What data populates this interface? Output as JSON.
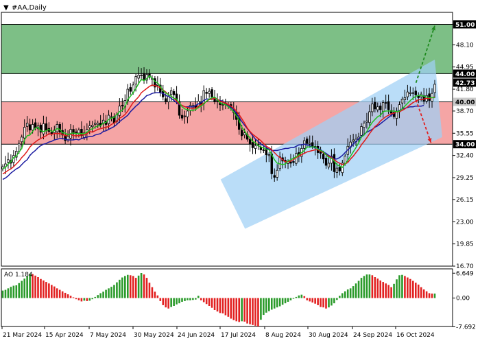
{
  "header": {
    "arrow": "▼",
    "symbol": "#AA,Daily"
  },
  "ao_label": "AO 1.184",
  "colors": {
    "bull": "#2a9a2a",
    "bear": "#e22020",
    "candle": "#000000",
    "ma_fast": "#22c022",
    "ma_mid": "#e01818",
    "ma_slow": "#1a1aa0",
    "zone_green": "#7dbf86",
    "zone_red": "#f5a5a5",
    "channel": "#9fd0f5",
    "arrow_up": "#1e8a1e",
    "arrow_down": "#e22020",
    "current_price": "#c9c9c9"
  },
  "chart_data": [
    {
      "type": "candlestick",
      "title": "#AA,Daily",
      "ylim": [
        16.7,
        52.7
      ],
      "price_ticks": [
        "51.00",
        "48.10",
        "44.95",
        "41.80",
        "38.70",
        "35.55",
        "32.40",
        "29.25",
        "26.15",
        "23.00",
        "19.85",
        "16.70"
      ],
      "levels": [
        {
          "value": "51.00",
          "color": "#000000",
          "text_color": "#ffffff"
        },
        {
          "value": "44.00",
          "color": "#000000",
          "text_color": "#ffffff"
        },
        {
          "value": "42.73",
          "color": "#000000",
          "text_color": "#ffffff"
        },
        {
          "value": "40.00",
          "color": "#c9c9c9",
          "text_color": "#000000"
        },
        {
          "value": "34.00",
          "color": "#000000",
          "text_color": "#ffffff"
        }
      ],
      "zones": [
        {
          "kind": "buy_target",
          "from": 44.0,
          "to": 51.0
        },
        {
          "kind": "sell_target",
          "from": 34.0,
          "to": 40.0
        }
      ],
      "channel": {
        "lower": [
          {
            "x": "2024-07-22",
            "y": 22.0
          },
          {
            "x": "2024-11-04",
            "y": 35.0
          }
        ],
        "upper": [
          {
            "x": "2024-07-09",
            "y": 29.0
          },
          {
            "x": "2024-10-31",
            "y": 46.0
          }
        ]
      },
      "arrows": [
        {
          "from": {
            "x": "2024-10-21",
            "y": 42.7
          },
          "to": {
            "x": "2024-10-31",
            "y": 50.8
          },
          "direction": "up"
        },
        {
          "from": {
            "x": "2024-10-21",
            "y": 40.3
          },
          "to": {
            "x": "2024-10-29",
            "y": 34.2
          },
          "direction": "down"
        }
      ],
      "x_labels": [
        "21 Mar 2024",
        "15 Apr 2024",
        "7 May 2024",
        "30 May 2024",
        "24 Jun 2024",
        "17 Jul 2024",
        "8 Aug 2024",
        "30 Aug 2024",
        "24 Sep 2024",
        "16 Oct 2024"
      ],
      "close": [
        30.8,
        31.2,
        31.8,
        31.3,
        32.4,
        33.0,
        34.1,
        35.0,
        36.4,
        37.0,
        36.0,
        36.8,
        36.3,
        36.6,
        35.7,
        36.9,
        36.0,
        35.8,
        35.5,
        36.0,
        36.8,
        35.7,
        35.3,
        34.5,
        35.1,
        36.1,
        35.5,
        35.7,
        36.0,
        35.2,
        35.6,
        36.1,
        36.6,
        36.7,
        37.0,
        37.0,
        36.7,
        37.4,
        36.8,
        38.1,
        37.9,
        37.0,
        38.2,
        39.4,
        39.5,
        40.2,
        41.8,
        41.5,
        42.4,
        43.6,
        43.8,
        43.8,
        43.2,
        43.9,
        43.5,
        43.3,
        42.1,
        42.5,
        41.4,
        40.7,
        40.0,
        40.8,
        41.6,
        41.0,
        40.3,
        38.1,
        37.7,
        38.0,
        38.7,
        39.5,
        39.5,
        39.2,
        40.1,
        39.6,
        41.6,
        41.2,
        41.5,
        40.7,
        40.0,
        40.2,
        39.6,
        39.6,
        39.6,
        39.5,
        39.1,
        38.5,
        37.5,
        36.1,
        35.2,
        35.6,
        34.7,
        34.0,
        33.5,
        33.8,
        33.8,
        33.2,
        33.1,
        32.5,
        32.5,
        29.8,
        29.3,
        30.3,
        32.2,
        31.6,
        31.5,
        31.5,
        31.3,
        31.4,
        32.7,
        32.5,
        33.4,
        34.5,
        34.1,
        34.1,
        33.7,
        33.7,
        32.8,
        32.7,
        31.9,
        31.0,
        31.3,
        32.3,
        30.1,
        30.6,
        30.2,
        31.3,
        32.3,
        33.7,
        34.3,
        34.6,
        34.7,
        35.0,
        36.5,
        37.0,
        37.3,
        38.6,
        39.7,
        39.0,
        39.3,
        38.9,
        39.9,
        39.8,
        38.9,
        38.4,
        37.9,
        38.6,
        39.6,
        40.4,
        40.6,
        41.4,
        41.3,
        41.3,
        41.0,
        40.6,
        41.1,
        40.1,
        40.9,
        40.2,
        41.2,
        42.5
      ],
      "ma_fast": [
        30.5,
        30.7,
        31.2,
        31.5,
        32.1,
        32.3,
        32.9,
        33.4,
        34.6,
        35.2,
        35.3,
        35.8,
        36.3,
        36.4,
        35.9,
        35.8,
        35.9,
        36.1,
        35.8,
        35.9,
        36.2,
        36.1,
        35.6,
        35.6,
        35.3,
        35.5,
        35.6,
        35.5,
        35.5,
        35.5,
        35.5,
        35.7,
        36.0,
        36.2,
        36.4,
        36.6,
        36.6,
        37.0,
        37.1,
        37.5,
        37.7,
        37.8,
        38.2,
        38.6,
        38.8,
        39.3,
        40.3,
        40.8,
        41.3,
        41.9,
        42.6,
        43.2,
        43.0,
        43.3,
        43.7,
        43.4,
        42.9,
        42.7,
        42.2,
        41.6,
        41.3,
        41.0,
        40.8,
        40.5,
        40.4,
        39.9,
        39.3,
        39.0,
        38.9,
        38.8,
        38.8,
        38.9,
        39.2,
        39.4,
        39.7,
        40.1,
        40.4,
        40.6,
        40.7,
        40.3,
        39.9,
        39.7,
        39.6,
        39.3,
        39.0,
        38.6,
        38.0,
        37.4,
        36.4,
        35.9,
        35.3,
        34.9,
        34.4,
        34.2,
        33.8,
        33.6,
        33.5,
        33.3,
        33.2,
        32.5,
        31.8,
        31.3,
        31.2,
        31.1,
        31.2,
        31.6,
        31.8,
        32.0,
        32.2,
        32.5,
        32.8,
        33.1,
        33.6,
        33.6,
        33.6,
        33.6,
        33.3,
        33.1,
        32.9,
        32.5,
        32.1,
        32.0,
        31.6,
        31.1,
        30.9,
        30.7,
        31.2,
        31.7,
        32.3,
        32.9,
        33.5,
        34.2,
        35.0,
        35.3,
        35.8,
        36.5,
        37.1,
        37.5,
        37.9,
        38.1,
        38.6,
        38.7,
        38.7,
        38.7,
        38.7,
        38.6,
        38.7,
        39.0,
        39.4,
        39.8,
        40.2,
        40.5,
        40.8,
        40.9,
        40.9,
        40.8,
        40.7,
        40.6,
        40.6,
        40.6
      ],
      "ma_mid": [
        29.8,
        30.0,
        30.3,
        30.5,
        30.8,
        31.2,
        31.6,
        32.1,
        32.5,
        33.0,
        33.6,
        34.0,
        34.3,
        34.6,
        34.8,
        35.0,
        35.2,
        35.5,
        35.4,
        35.5,
        35.5,
        35.5,
        35.4,
        35.2,
        35.3,
        35.4,
        35.2,
        35.2,
        35.2,
        35.3,
        35.3,
        35.5,
        35.8,
        35.7,
        35.9,
        36.1,
        36.2,
        36.3,
        36.4,
        36.5,
        36.8,
        37.0,
        37.3,
        37.7,
        37.9,
        38.2,
        38.7,
        39.3,
        39.9,
        40.3,
        40.7,
        41.3,
        41.6,
        41.9,
        42.2,
        42.4,
        42.3,
        42.2,
        42.0,
        41.7,
        41.4,
        41.0,
        40.8,
        40.5,
        40.1,
        39.7,
        39.5,
        39.3,
        39.2,
        39.1,
        39.1,
        39.1,
        39.4,
        39.6,
        39.8,
        40.1,
        40.3,
        40.4,
        40.5,
        40.4,
        40.1,
        40.0,
        39.8,
        39.6,
        39.4,
        39.1,
        38.7,
        38.2,
        37.6,
        37.0,
        36.3,
        35.8,
        35.4,
        35.1,
        34.8,
        34.5,
        34.1,
        33.7,
        33.5,
        33.2,
        32.8,
        32.4,
        32.1,
        31.8,
        31.5,
        31.5,
        31.6,
        31.8,
        32.1,
        32.3,
        32.5,
        32.7,
        32.9,
        33.0,
        33.1,
        33.2,
        33.2,
        33.0,
        32.8,
        32.5,
        32.3,
        32.1,
        31.8,
        31.5,
        31.3,
        31.1,
        31.2,
        31.4,
        31.9,
        32.3,
        32.8,
        33.3,
        33.9,
        34.4,
        34.9,
        35.5,
        36.0,
        36.5,
        36.8,
        37.3,
        37.6,
        37.9,
        38.1,
        38.3,
        38.4,
        38.6,
        38.6,
        38.8,
        39.0,
        39.3,
        39.6,
        39.9,
        40.1,
        40.3,
        40.3,
        40.4,
        40.5,
        40.5,
        40.6,
        40.7
      ],
      "ma_slow": [
        29.0,
        29.2,
        29.5,
        29.9,
        30.2,
        30.5,
        30.7,
        31.1,
        31.5,
        31.8,
        32.4,
        32.8,
        33.1,
        33.5,
        33.8,
        34.0,
        34.1,
        34.3,
        34.4,
        34.6,
        34.7,
        34.8,
        34.8,
        34.7,
        34.6,
        34.6,
        34.6,
        34.7,
        34.6,
        34.8,
        34.9,
        35.0,
        35.1,
        35.1,
        35.3,
        35.4,
        35.5,
        35.8,
        35.9,
        36.1,
        36.3,
        36.5,
        36.8,
        37.2,
        37.5,
        37.8,
        38.1,
        38.6,
        39.0,
        39.4,
        39.7,
        40.2,
        40.5,
        40.9,
        41.0,
        41.2,
        41.3,
        41.3,
        41.3,
        41.2,
        40.9,
        40.8,
        40.5,
        40.2,
        39.9,
        39.6,
        39.5,
        39.3,
        39.3,
        39.3,
        39.3,
        39.5,
        39.7,
        39.9,
        40.2,
        40.4,
        40.4,
        40.4,
        40.5,
        40.3,
        40.2,
        40.1,
        39.8,
        39.5,
        39.2,
        38.9,
        38.4,
        37.8,
        37.2,
        36.7,
        36.2,
        35.7,
        35.2,
        34.7,
        34.4,
        34.0,
        33.8,
        33.5,
        33.3,
        33.1,
        33.1,
        33.1,
        33.2,
        33.3,
        33.4,
        33.4,
        33.5,
        33.5,
        33.7,
        33.9,
        33.9,
        34.0,
        33.9,
        33.8,
        33.6,
        33.5,
        33.4,
        33.2,
        32.9,
        32.7,
        32.4,
        32.2,
        31.9,
        31.9,
        32.1,
        32.4,
        32.8,
        33.2,
        33.6,
        34.0,
        34.4,
        34.8,
        35.1,
        35.4,
        35.7,
        35.9,
        36.1,
        36.4,
        36.6,
        36.9,
        37.2,
        37.5,
        37.8,
        38.1,
        38.4,
        38.6,
        38.8,
        39.0,
        39.1,
        39.2,
        39.3,
        39.3,
        39.4,
        39.4,
        39.4,
        39.5
      ]
    },
    {
      "type": "histogram",
      "title": "AO",
      "ylim": [
        -7.6,
        7.8
      ],
      "tick_labels": [
        "6.649",
        "0.00",
        "-7.692"
      ],
      "last_value": "1.184",
      "values": [
        2.0,
        2.2,
        2.6,
        3.0,
        3.3,
        3.4,
        4.0,
        4.6,
        5.2,
        5.8,
        6.5,
        6.4,
        6.0,
        5.6,
        5.1,
        4.7,
        4.3,
        3.9,
        3.5,
        3.1,
        2.6,
        2.2,
        1.8,
        1.4,
        1.0,
        0.6,
        0.2,
        -0.3,
        -0.6,
        -0.9,
        -0.7,
        -0.8,
        -0.7,
        -0.3,
        0.3,
        0.8,
        1.3,
        1.7,
        2.2,
        2.6,
        3.0,
        3.5,
        4.2,
        4.9,
        5.5,
        5.9,
        6.2,
        6.1,
        5.9,
        5.4,
        6.0,
        6.7,
        6.3,
        5.4,
        4.1,
        2.9,
        1.7,
        0.7,
        -0.8,
        -1.9,
        -2.5,
        -2.8,
        -2.4,
        -2.1,
        -1.7,
        -1.4,
        -1.0,
        -0.8,
        -0.6,
        -0.6,
        -0.5,
        -0.4,
        0.6,
        -0.6,
        -1.1,
        -1.6,
        -2.1,
        -2.6,
        -3.2,
        -3.6,
        -4.0,
        -4.1,
        -4.6,
        -5.0,
        -5.5,
        -5.9,
        -6.2,
        -6.4,
        -6.2,
        -6.3,
        -6.8,
        -7.0,
        -7.2,
        -7.4,
        -7.6,
        -5.8,
        -4.5,
        -3.9,
        -3.5,
        -3.1,
        -2.8,
        -2.5,
        -2.2,
        -1.8,
        -1.4,
        -1.0,
        -0.6,
        -0.2,
        0.3,
        0.7,
        0.9,
        0.5,
        -0.6,
        -0.9,
        -1.2,
        -1.5,
        -1.9,
        -2.4,
        -2.5,
        -2.8,
        -2.5,
        -2.0,
        -1.4,
        -0.5,
        0.6,
        1.3,
        1.8,
        2.3,
        2.6,
        3.2,
        3.9,
        4.6,
        5.4,
        5.9,
        6.3,
        6.3,
        6.1,
        5.6,
        5.2,
        4.7,
        4.3,
        3.9,
        3.5,
        2.9,
        3.8,
        5.0,
        6.1,
        6.2,
        5.9,
        5.5,
        5.1,
        4.6,
        4.1,
        3.6,
        2.9,
        2.3,
        1.8,
        1.3,
        1.2,
        1.2
      ]
    }
  ]
}
